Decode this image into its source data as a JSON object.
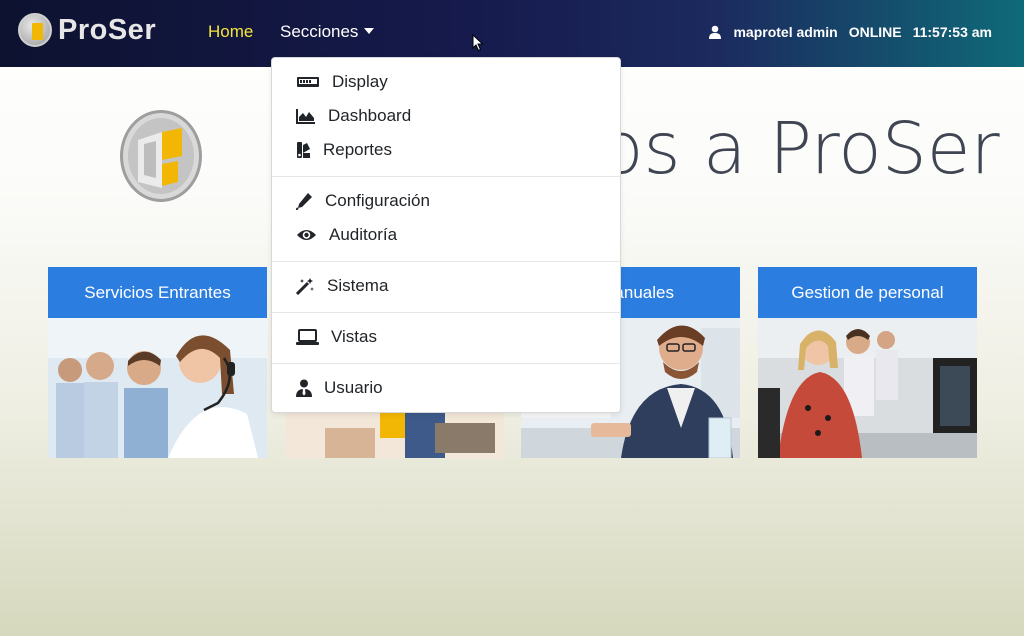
{
  "navbar": {
    "brand": "ProSer",
    "home_label": "Home",
    "secciones_label": "Secciones",
    "user_name": "maprotel admin",
    "status": "ONLINE",
    "time": "11:57:53 am"
  },
  "hero": {
    "title": "os a ProSer"
  },
  "cards": [
    {
      "label": "Servicios Entrantes"
    },
    {
      "label": ""
    },
    {
      "label": "s Manuales"
    },
    {
      "label": "Gestion de personal"
    }
  ],
  "dropdown": {
    "items": [
      {
        "label": "Display",
        "icon": "display-icon"
      },
      {
        "label": "Dashboard",
        "icon": "area-chart-icon"
      },
      {
        "label": "Reportes",
        "icon": "swatches-icon"
      },
      {
        "label": "Configuración",
        "icon": "pen-icon"
      },
      {
        "label": "Auditoría",
        "icon": "eye-icon"
      },
      {
        "label": "Sistema",
        "icon": "magic-wand-icon"
      },
      {
        "label": "Vistas",
        "icon": "laptop-icon"
      },
      {
        "label": "Usuario",
        "icon": "user-tie-icon"
      }
    ]
  },
  "colors": {
    "navbar_start": "#0d1230",
    "navbar_end": "#0f6a78",
    "home_active": "#f5e33a",
    "card_header": "#2b7de0"
  }
}
